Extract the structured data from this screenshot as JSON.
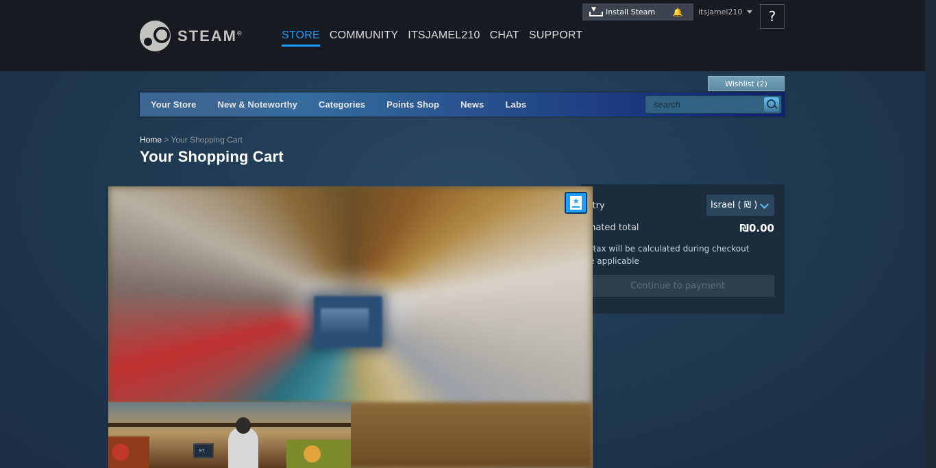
{
  "header": {
    "logo_text": "STEAM",
    "logo_mark": "®",
    "nav": [
      "STORE",
      "COMMUNITY",
      "ITSJAMEL210",
      "CHAT",
      "SUPPORT"
    ],
    "install_label": "Install Steam",
    "account_name": "itsjamel210",
    "help_label": "?"
  },
  "store_nav": {
    "wishlist_label": "Wishlist (2)",
    "items": [
      "Your Store",
      "New & Noteworthy",
      "Categories",
      "Points Shop",
      "News",
      "Labs"
    ],
    "search_placeholder": "search"
  },
  "breadcrumb": {
    "home": "Home",
    "separator": " > ",
    "current": "Your Shopping Cart"
  },
  "page_title": "Your Shopping Cart",
  "summary": {
    "country_label": "untry",
    "country_value": "Israel ( ₪ )",
    "total_label": "timated total",
    "total_value": "₪0.00",
    "tax_note_line1": "es tax will be calculated during checkout",
    "tax_note_line2": "ere applicable",
    "continue_label": "Continue to payment"
  },
  "media": {
    "register_number": "97"
  },
  "colors": {
    "accent": "#1a9fff",
    "header_bg": "#171a21",
    "page_bg": "#1b2838"
  }
}
